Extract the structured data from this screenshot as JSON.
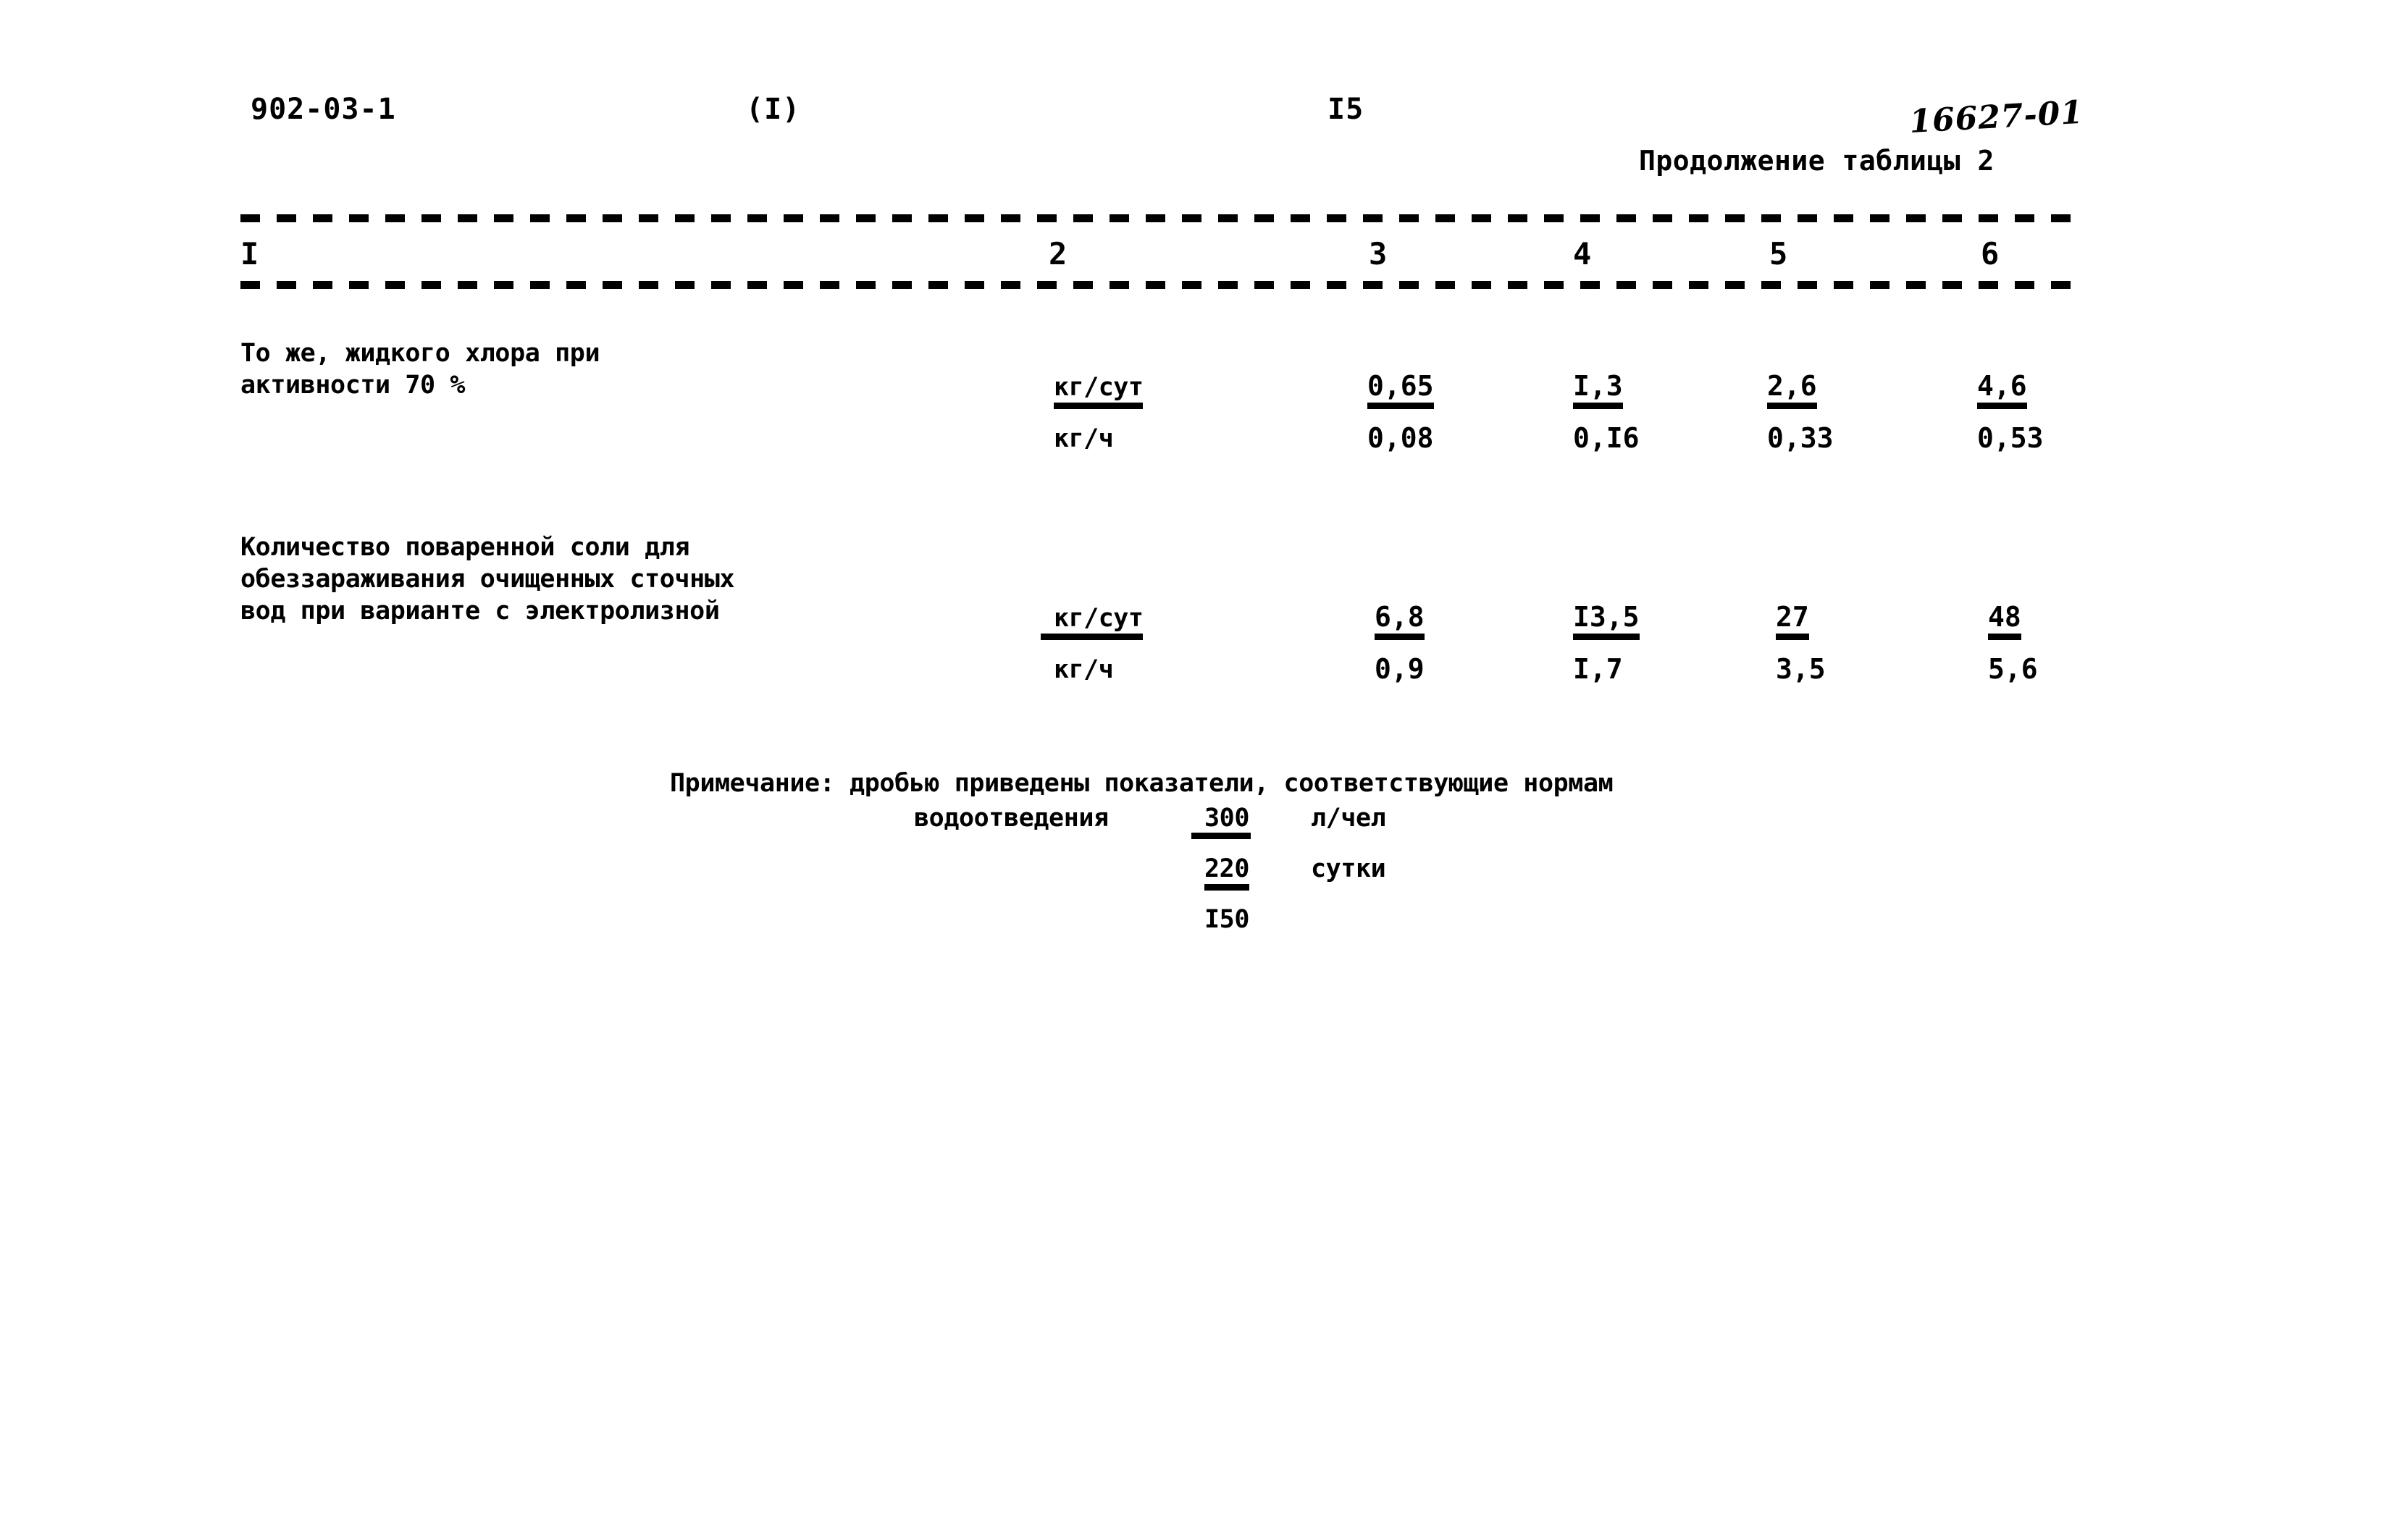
{
  "header": {
    "doc_code": "902-03-1",
    "variant_mark": "(I)",
    "page_number": "I5",
    "table_continued": "Продолжение таблицы 2",
    "archive_number": "16627-01"
  },
  "table": {
    "column_headers": [
      "I",
      "2",
      "3",
      "4",
      "5",
      "6"
    ],
    "rows": [
      {
        "label": "То же, жидкого хлора при\nактивности 70 %",
        "lines": [
          {
            "unit": "кг/сут",
            "unit_underlined": true,
            "values": [
              "0,65",
              "I,3",
              "2,6",
              "4,6"
            ],
            "values_underlined": true
          },
          {
            "unit": "кг/ч",
            "unit_underlined": false,
            "values": [
              "0,08",
              "0,I6",
              "0,33",
              "0,53"
            ],
            "values_underlined": false
          }
        ]
      },
      {
        "label": "Количество поваренной соли для\nобеззараживания очищенных сточных\nвод  при варианте с электролизной",
        "lines": [
          {
            "unit": "кг/сут",
            "unit_underlined": true,
            "values": [
              "6,8",
              "I3,5",
              "27",
              "48"
            ],
            "values_underlined": true
          },
          {
            "unit": "кг/ч",
            "unit_underlined": false,
            "values": [
              "0,9",
              "I,7",
              "3,5",
              "5,6"
            ],
            "values_underlined": false
          }
        ]
      }
    ]
  },
  "note": {
    "line1": "Примечание: дробью приведены показатели, соответствующие нормам",
    "line2": "водоотведения",
    "fraction_top": "300",
    "unit_top": "л/чел",
    "fraction_mid": "220",
    "unit_mid": "сутки",
    "fraction_bottom": "I50"
  }
}
